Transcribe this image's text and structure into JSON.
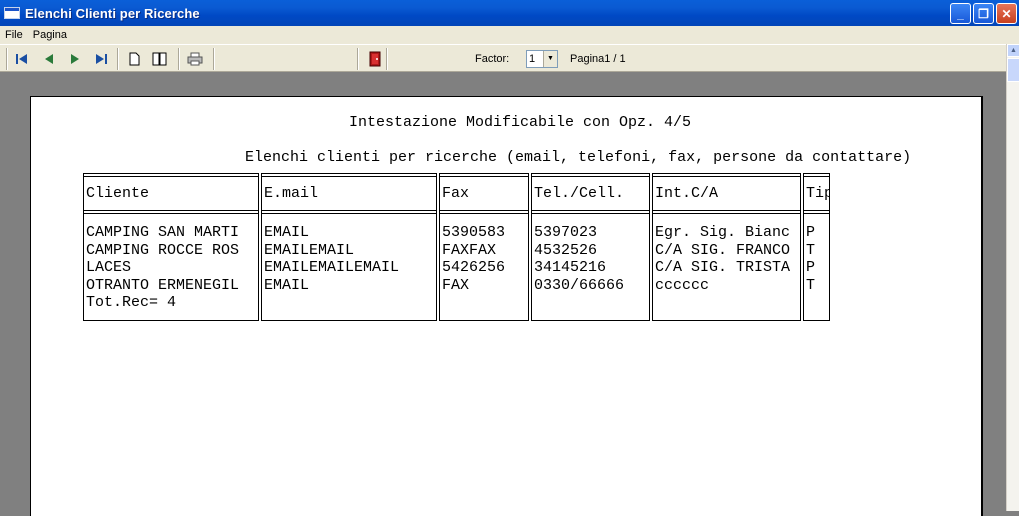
{
  "window": {
    "title": "Elenchi Clienti per Ricerche",
    "buttons": {
      "minimize": "_",
      "maximize": "❐",
      "close": "✕"
    }
  },
  "menu": [
    "File",
    "Pagina"
  ],
  "toolbar": {
    "factor_label": "Factor:",
    "factor_value": "1",
    "page_label": "Pagina1 / 1"
  },
  "report": {
    "header_line1": "Intestazione Modificabile con Opz. 4/5",
    "header_line2": "Elenchi clienti per ricerche (email, telefoni, fax, persone da contattare)",
    "columns": [
      {
        "header": "Cliente",
        "values": [
          "CAMPING SAN MARTI",
          "CAMPING ROCCE ROS",
          "LACES",
          "OTRANTO ERMENEGIL",
          "Tot.Rec= 4"
        ]
      },
      {
        "header": "E.mail",
        "values": [
          "EMAIL",
          "EMAILEMAIL",
          "EMAILEMAILEMAIL",
          "EMAIL"
        ]
      },
      {
        "header": "Fax",
        "values": [
          "5390583",
          "FAXFAX",
          "5426256",
          "FAX"
        ]
      },
      {
        "header": "Tel./Cell.",
        "values": [
          "5397023",
          "4532526",
          "34145216",
          "0330/66666"
        ]
      },
      {
        "header": "Int.C/A",
        "values": [
          "Egr. Sig. Bianc",
          "C/A SIG. FRANCO",
          "C/A SIG. TRISTA",
          "cccccc"
        ]
      },
      {
        "header": "Tipo",
        "values": [
          "P",
          "T",
          "P",
          "T"
        ]
      }
    ]
  }
}
